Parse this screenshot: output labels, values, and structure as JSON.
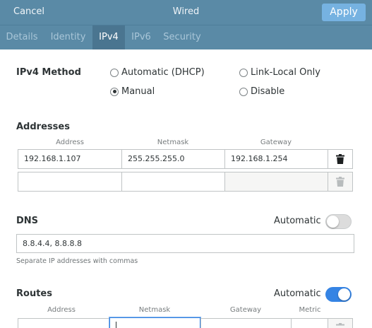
{
  "titlebar": {
    "cancel_label": "Cancel",
    "title": "Wired",
    "apply_label": "Apply"
  },
  "tabs": [
    {
      "label": "Details"
    },
    {
      "label": "Identity"
    },
    {
      "label": "IPv4"
    },
    {
      "label": "IPv6"
    },
    {
      "label": "Security"
    }
  ],
  "ipv4_method": {
    "label": "IPv4 Method",
    "options": [
      {
        "label": "Automatic (DHCP)",
        "selected": false
      },
      {
        "label": "Link-Local Only",
        "selected": false
      },
      {
        "label": "Manual",
        "selected": true
      },
      {
        "label": "Disable",
        "selected": false
      }
    ]
  },
  "addresses": {
    "label": "Addresses",
    "columns": [
      "Address",
      "Netmask",
      "Gateway"
    ],
    "rows": [
      {
        "address": "192.168.1.107",
        "netmask": "255.255.255.0",
        "gateway": "192.168.1.254"
      },
      {
        "address": "",
        "netmask": "",
        "gateway": ""
      }
    ]
  },
  "dns": {
    "label": "DNS",
    "automatic_label": "Automatic",
    "automatic_on": false,
    "value": "8.8.4.4, 8.8.8.8",
    "hint": "Separate IP addresses with commas"
  },
  "routes": {
    "label": "Routes",
    "automatic_label": "Automatic",
    "automatic_on": true,
    "columns": [
      "Address",
      "Netmask",
      "Gateway",
      "Metric"
    ]
  },
  "colors": {
    "header": "#5a8aa6",
    "active_tab": "#4a7590",
    "apply": "#76b2e1",
    "toggle_on": "#3584e4",
    "toggle_off": "#dcdcdc"
  }
}
